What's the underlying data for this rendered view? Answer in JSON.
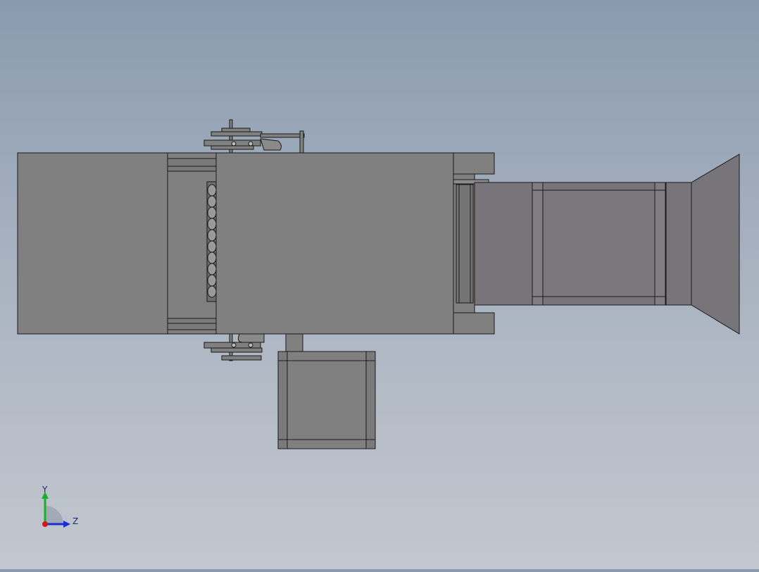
{
  "viewport": {
    "background_top": "#8a9aae",
    "background_bottom": "#c3c7ce",
    "part_fill": "#808080",
    "part_fill_dark": "#777579",
    "edge_color": "#1a1a1a"
  },
  "triad": {
    "y_label": "Y",
    "z_label": "Z",
    "y_color": "#19b02a",
    "z_color": "#1b2fd0",
    "x_color": "#d01818"
  }
}
